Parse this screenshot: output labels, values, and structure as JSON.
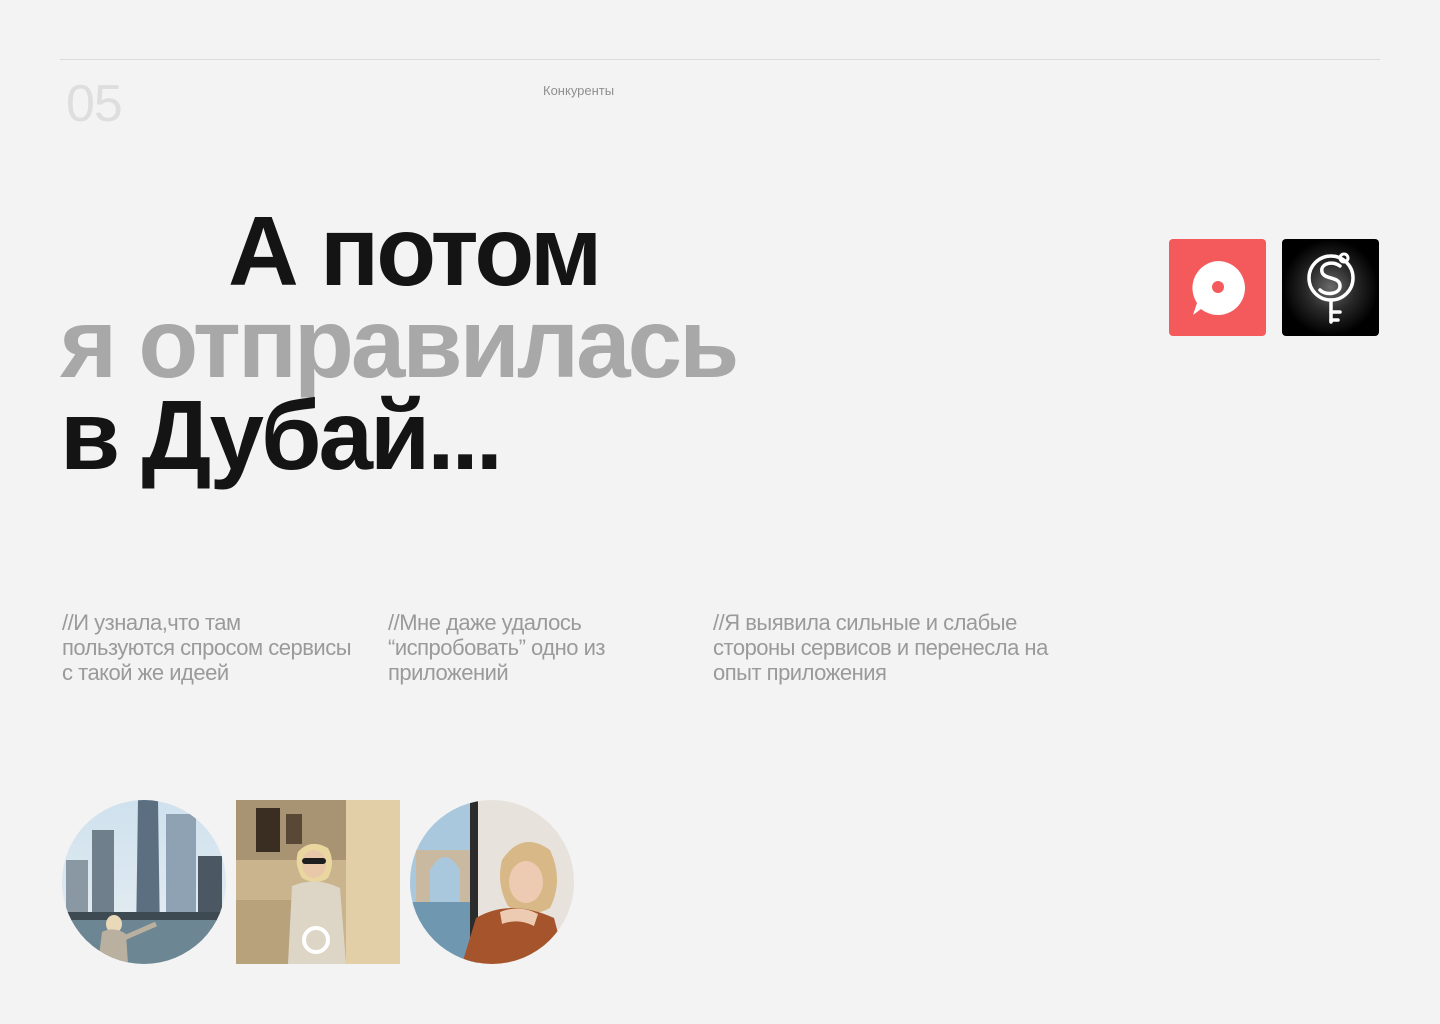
{
  "header": {
    "page_number": "05",
    "section_label": "Конкуренты"
  },
  "headline": {
    "line1": "А потом",
    "line2": "я отправилась",
    "line3": "в Дубай..."
  },
  "colors": {
    "background": "#f3f3f3",
    "text_dark": "#141414",
    "text_muted": "#a8a8a8",
    "logo_red": "#f45a5c",
    "logo_black": "#000000"
  },
  "logos": [
    {
      "icon": "map-pin-chat-icon",
      "background": "#f45a5c"
    },
    {
      "icon": "key-s-monogram-icon",
      "background": "#000000"
    }
  ],
  "notes": [
    "//И узнала,что там пользуются спросом сервисы с такой же идеей",
    "//Мне даже удалось “испробовать” одно из приложений",
    "//Я выявила сильные и слабые стороны сервисов и перенесла на опыт приложения"
  ],
  "photos": [
    {
      "shape": "circle",
      "icon": "city-skyline-photo"
    },
    {
      "shape": "square",
      "icon": "portrait-wall-photo"
    },
    {
      "shape": "circle",
      "icon": "window-view-photo"
    }
  ]
}
